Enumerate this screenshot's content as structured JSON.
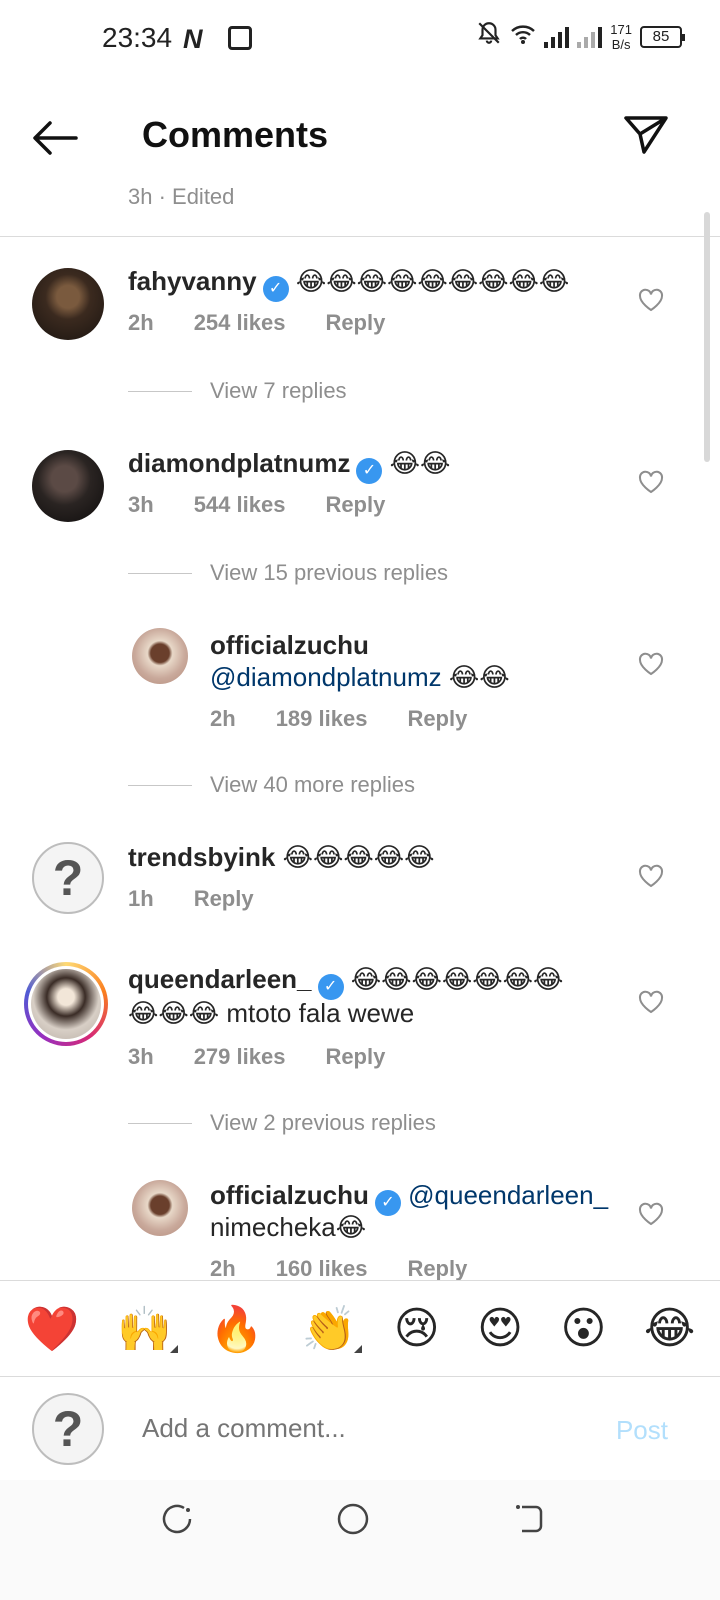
{
  "status_bar": {
    "time": "23:34",
    "speed_value": "171",
    "speed_unit": "B/s",
    "battery": "85"
  },
  "header": {
    "title": "Comments",
    "caption_meta": "3h · Edited"
  },
  "comments": [
    {
      "username": "fahyvanny",
      "verified": true,
      "text": "😂😂😂😂😂😂😂😂😂",
      "time": "2h",
      "likes": "254 likes",
      "reply_label": "Reply",
      "view_replies": "View 7 replies"
    },
    {
      "username": "diamondplatnumz",
      "verified": true,
      "text": "😂😂",
      "time": "3h",
      "likes": "544 likes",
      "reply_label": "Reply",
      "view_replies": "View 15 previous replies",
      "reply": {
        "username": "officialzuchu",
        "mention": "@diamondplatnumz",
        "text": "😂😂",
        "time": "2h",
        "likes": "189 likes",
        "reply_label": "Reply"
      },
      "view_more": "View 40 more replies"
    },
    {
      "username": "trendsbyink",
      "verified": false,
      "text": "😂😂😂😂😂",
      "time": "1h",
      "reply_label": "Reply"
    },
    {
      "username": "queendarleen_",
      "verified": true,
      "text": "😂😂😂😂😂😂😂",
      "text2": "😂😂😂 mtoto fala wewe",
      "time": "3h",
      "likes": "279 likes",
      "reply_label": "Reply",
      "view_replies": "View 2 previous replies",
      "reply": {
        "username": "officialzuchu",
        "mention": "@queendarleen_",
        "text": "nimecheka😂",
        "time": "2h",
        "likes": "160 likes",
        "reply_label": "Reply"
      }
    }
  ],
  "quick_emojis": [
    "❤️",
    "🙌",
    "🔥",
    "👏",
    "😢",
    "😍",
    "😮",
    "😂"
  ],
  "composer": {
    "placeholder": "Add a comment...",
    "post_label": "Post"
  },
  "icons": {
    "verified": "✓",
    "question_avatar": "?"
  }
}
